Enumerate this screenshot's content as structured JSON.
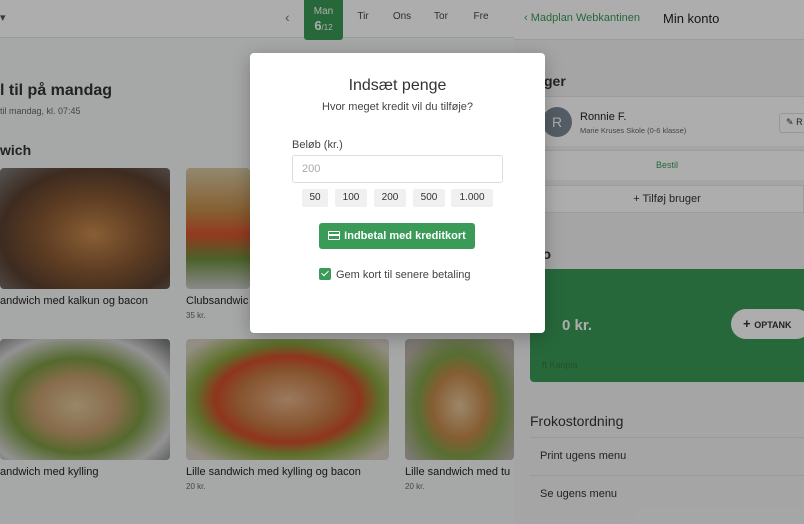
{
  "left": {
    "days": [
      {
        "label": "Man",
        "num": "6",
        "month": "/12",
        "active": true
      },
      {
        "label": "Tir"
      },
      {
        "label": "Ons"
      },
      {
        "label": "Tor"
      },
      {
        "label": "Fre"
      }
    ],
    "heading": "l til på mandag",
    "subheading": "til mandag, kl. 07:45",
    "category": "wich",
    "products": [
      {
        "name": "andwich med kalkun og bacon",
        "price": ""
      },
      {
        "name": "Clubsandwic",
        "price": "35 kr."
      },
      {
        "name": "andwich med kylling",
        "price": ""
      },
      {
        "name": "Lille sandwich med kylling og bacon",
        "price": "20 kr."
      },
      {
        "name": "Lille sandwich med tu",
        "price": "20 kr."
      }
    ]
  },
  "drawer": {
    "back_label": "Madplan Webkantinen",
    "title": "Min konto",
    "users_title": "ruger",
    "user": {
      "initial": "R",
      "name": "Ronnie F.",
      "school": "Marie Kruses Skole (0-6 klasse)",
      "edit_label": "R"
    },
    "order_label": "Bestil",
    "add_user_label": "Tilføj bruger",
    "balance_title": "ldo",
    "balance": "0 kr.",
    "topup_label": "OPTANK",
    "card_ref": "ft Kanpla",
    "lunch_title": "Frokostordning",
    "lunch_items": [
      "Print ugens menu",
      "Se ugens menu"
    ]
  },
  "modal": {
    "title": "Indsæt penge",
    "subtitle": "Hvor meget kredit vil du tilføje?",
    "amount_label": "Beløb (kr.)",
    "amount_placeholder": "200",
    "presets": [
      "50",
      "100",
      "200",
      "500",
      "1.000"
    ],
    "pay_label": "Indbetal med kreditkort",
    "save_card_label": "Gem kort til senere betaling"
  },
  "colors": {
    "accent": "#3a9a57",
    "overlay": "rgba(0,0,0,0.32)"
  }
}
